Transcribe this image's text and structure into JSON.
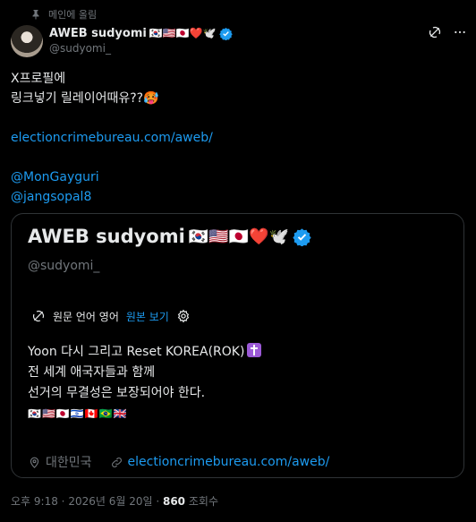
{
  "pinned": {
    "label": "메인에 올림",
    "icon": "pin-icon"
  },
  "header": {
    "display_name": "AWEB sudyomi",
    "name_emojis": "🇰🇷🇺🇸🇯🇵❤️🕊️",
    "handle": "@sudyomi_"
  },
  "post": {
    "lines": [
      {
        "text": "X프로필에",
        "type": "text"
      },
      {
        "text": "링크넣기 릴레이어때유??🥵",
        "type": "text"
      },
      {
        "text": "",
        "type": "text"
      },
      {
        "text": "electioncrimebureau.com/aweb/",
        "type": "link"
      },
      {
        "text": "",
        "type": "text"
      },
      {
        "text": "@MonGayguri",
        "type": "link"
      },
      {
        "text": "@jangsopal8",
        "type": "link"
      }
    ]
  },
  "card": {
    "display_name": "AWEB sudyomi",
    "name_emojis": "🇰🇷🇺🇸🇯🇵❤️🕊️",
    "handle": "@sudyomi_",
    "translate": {
      "source_label": "원문 언어 영어",
      "view_original": "원본 보기"
    },
    "bio": {
      "line1": "Yoon 다시 그리고 Reset KOREA(ROK)",
      "line2": "전 세계 애국자들과 함께",
      "line3": "선거의 무결성은 보장되어야 한다.",
      "flags": "🇰🇷🇺🇸🇯🇵🇮🇱🇨🇦🇧🇷🇬🇧"
    },
    "location": "대한민국",
    "website": "electioncrimebureau.com/aweb/"
  },
  "footer": {
    "time": "오후 9:18",
    "date": "2026년 6월 20일",
    "views": "860",
    "views_label": "조회수"
  },
  "colors": {
    "background": "#000000",
    "text": "#e7e9ea",
    "muted": "#71767b",
    "link": "#1d9bf0",
    "border": "#2f3336"
  }
}
